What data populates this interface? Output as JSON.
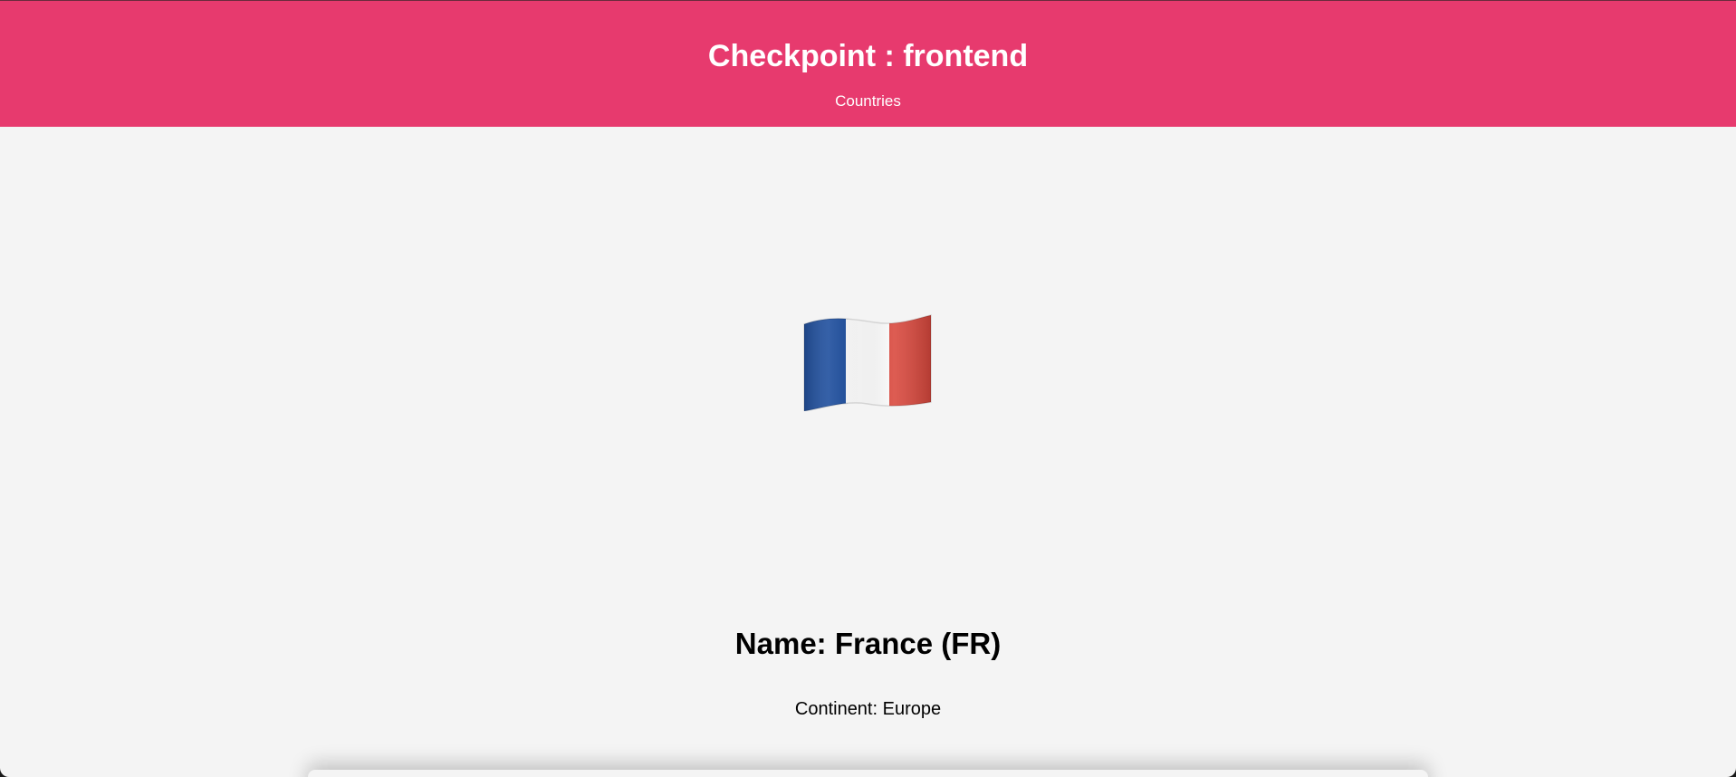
{
  "header": {
    "title": "Checkpoint : frontend",
    "nav_link": "Countries",
    "background_color": "#e73a6e"
  },
  "country": {
    "flag_icon": "france-flag-icon",
    "name_line": "Name: France (FR)",
    "continent_line": "Continent: Europe",
    "flag_colors": [
      "#1f4f9e",
      "#ffffff",
      "#d9463b"
    ]
  }
}
